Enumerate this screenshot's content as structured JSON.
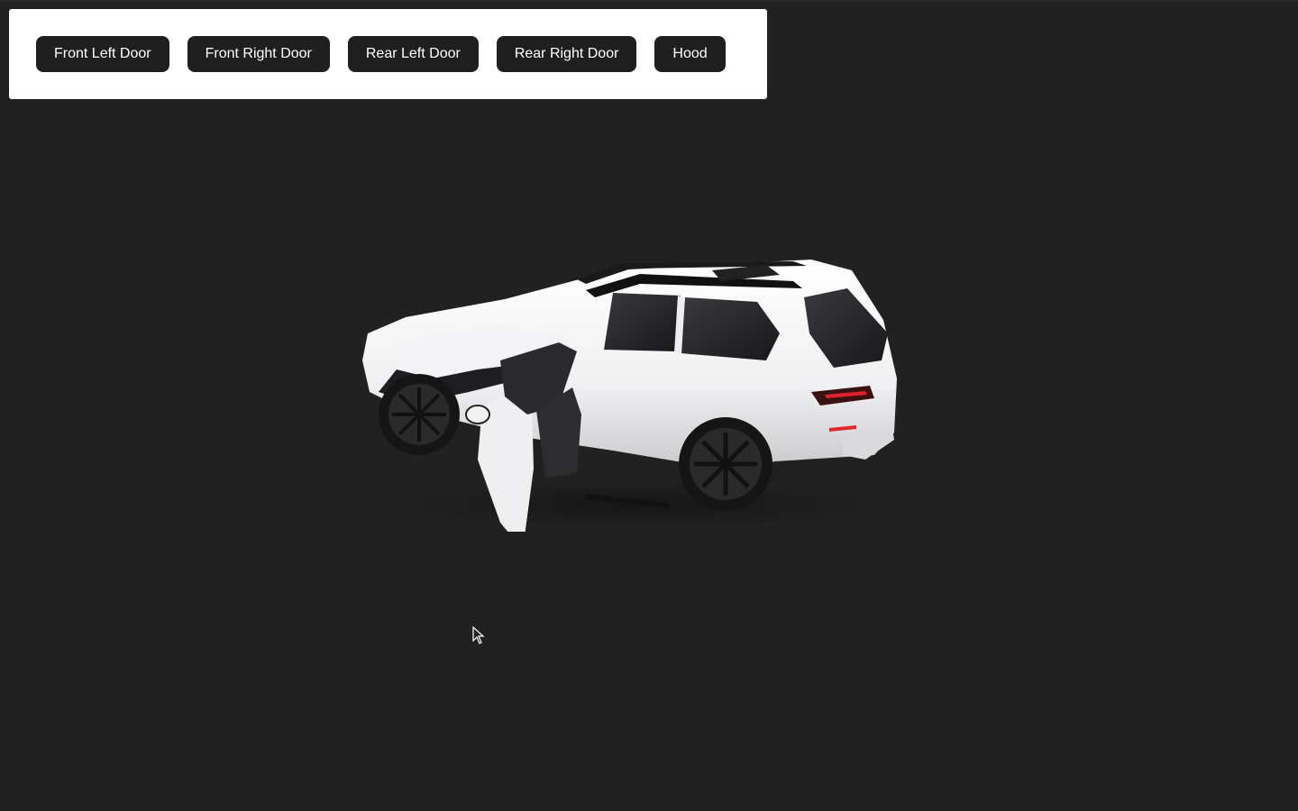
{
  "controls": {
    "buttons": [
      {
        "label": "Front Left Door"
      },
      {
        "label": "Front Right Door"
      },
      {
        "label": "Rear Left Door"
      },
      {
        "label": "Rear Right Door"
      },
      {
        "label": "Hood"
      }
    ]
  },
  "scene": {
    "background_color": "#212121",
    "model": {
      "body_color": "#f2f2f4",
      "state": {
        "front_left_door": "open",
        "hood": "open"
      }
    }
  },
  "cursor": {
    "icon": "arrow-cursor-icon"
  }
}
